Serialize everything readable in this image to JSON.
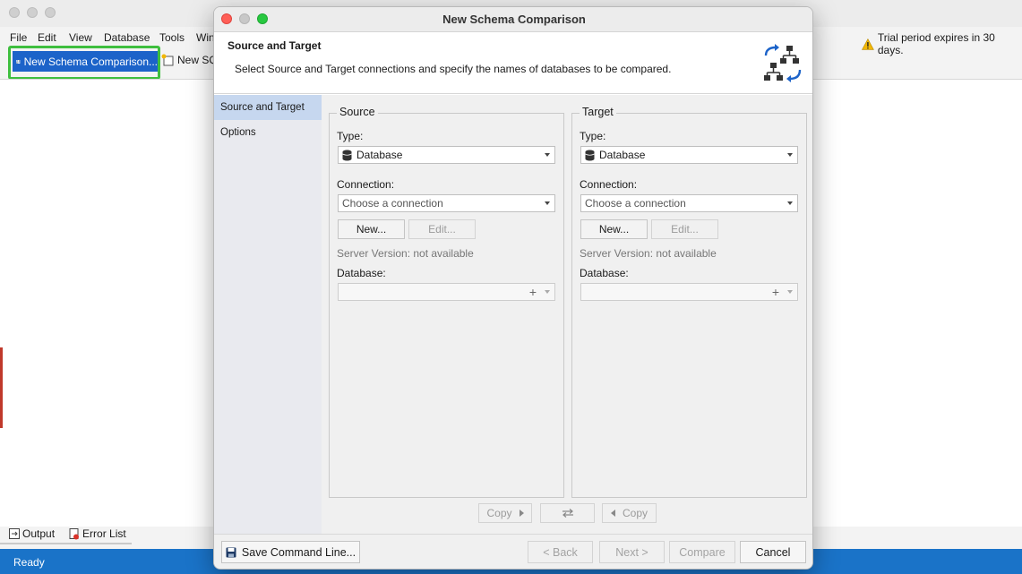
{
  "main_window": {
    "menu": [
      "File",
      "Edit",
      "View",
      "Database",
      "Tools",
      "Win"
    ],
    "toolbar": {
      "new_schema_comparison": "New Schema Comparison...",
      "new_sql": "New SQ"
    },
    "trial_notice": "Trial period expires in 30 days.",
    "bottom_tabs": [
      "Output",
      "Error List"
    ],
    "status": "Ready"
  },
  "dialog": {
    "title": "New Schema Comparison",
    "header": {
      "title": "Source and Target",
      "description": "Select Source and Target connections and specify the names of databases to be compared."
    },
    "nav": [
      {
        "label": "Source and Target",
        "active": true
      },
      {
        "label": "Options",
        "active": false
      }
    ],
    "source": {
      "group_title": "Source",
      "type_label": "Type:",
      "type_value": "Database",
      "connection_label": "Connection:",
      "connection_placeholder": "Choose a connection",
      "new_button": "New...",
      "edit_button": "Edit...",
      "server_version": "Server Version: not available",
      "database_label": "Database:"
    },
    "target": {
      "group_title": "Target",
      "type_label": "Type:",
      "type_value": "Database",
      "connection_label": "Connection:",
      "connection_placeholder": "Choose a connection",
      "new_button": "New...",
      "edit_button": "Edit...",
      "server_version": "Server Version: not available",
      "database_label": "Database:"
    },
    "copy_buttons": {
      "copy_right": "Copy",
      "swap_icon": "swap-icon",
      "copy_left": "Copy"
    },
    "footer": {
      "save_command_line": "Save Command Line...",
      "back": "< Back",
      "next": "Next >",
      "compare": "Compare",
      "cancel": "Cancel"
    }
  },
  "colors": {
    "accent": "#1c63c9",
    "statusbar": "#1a73c8",
    "highlight": "#3fbf3f",
    "nav_active": "#c6d7ef",
    "close": "#ff5f57",
    "minimize": "#c8c8c8",
    "maximize": "#28c840"
  }
}
